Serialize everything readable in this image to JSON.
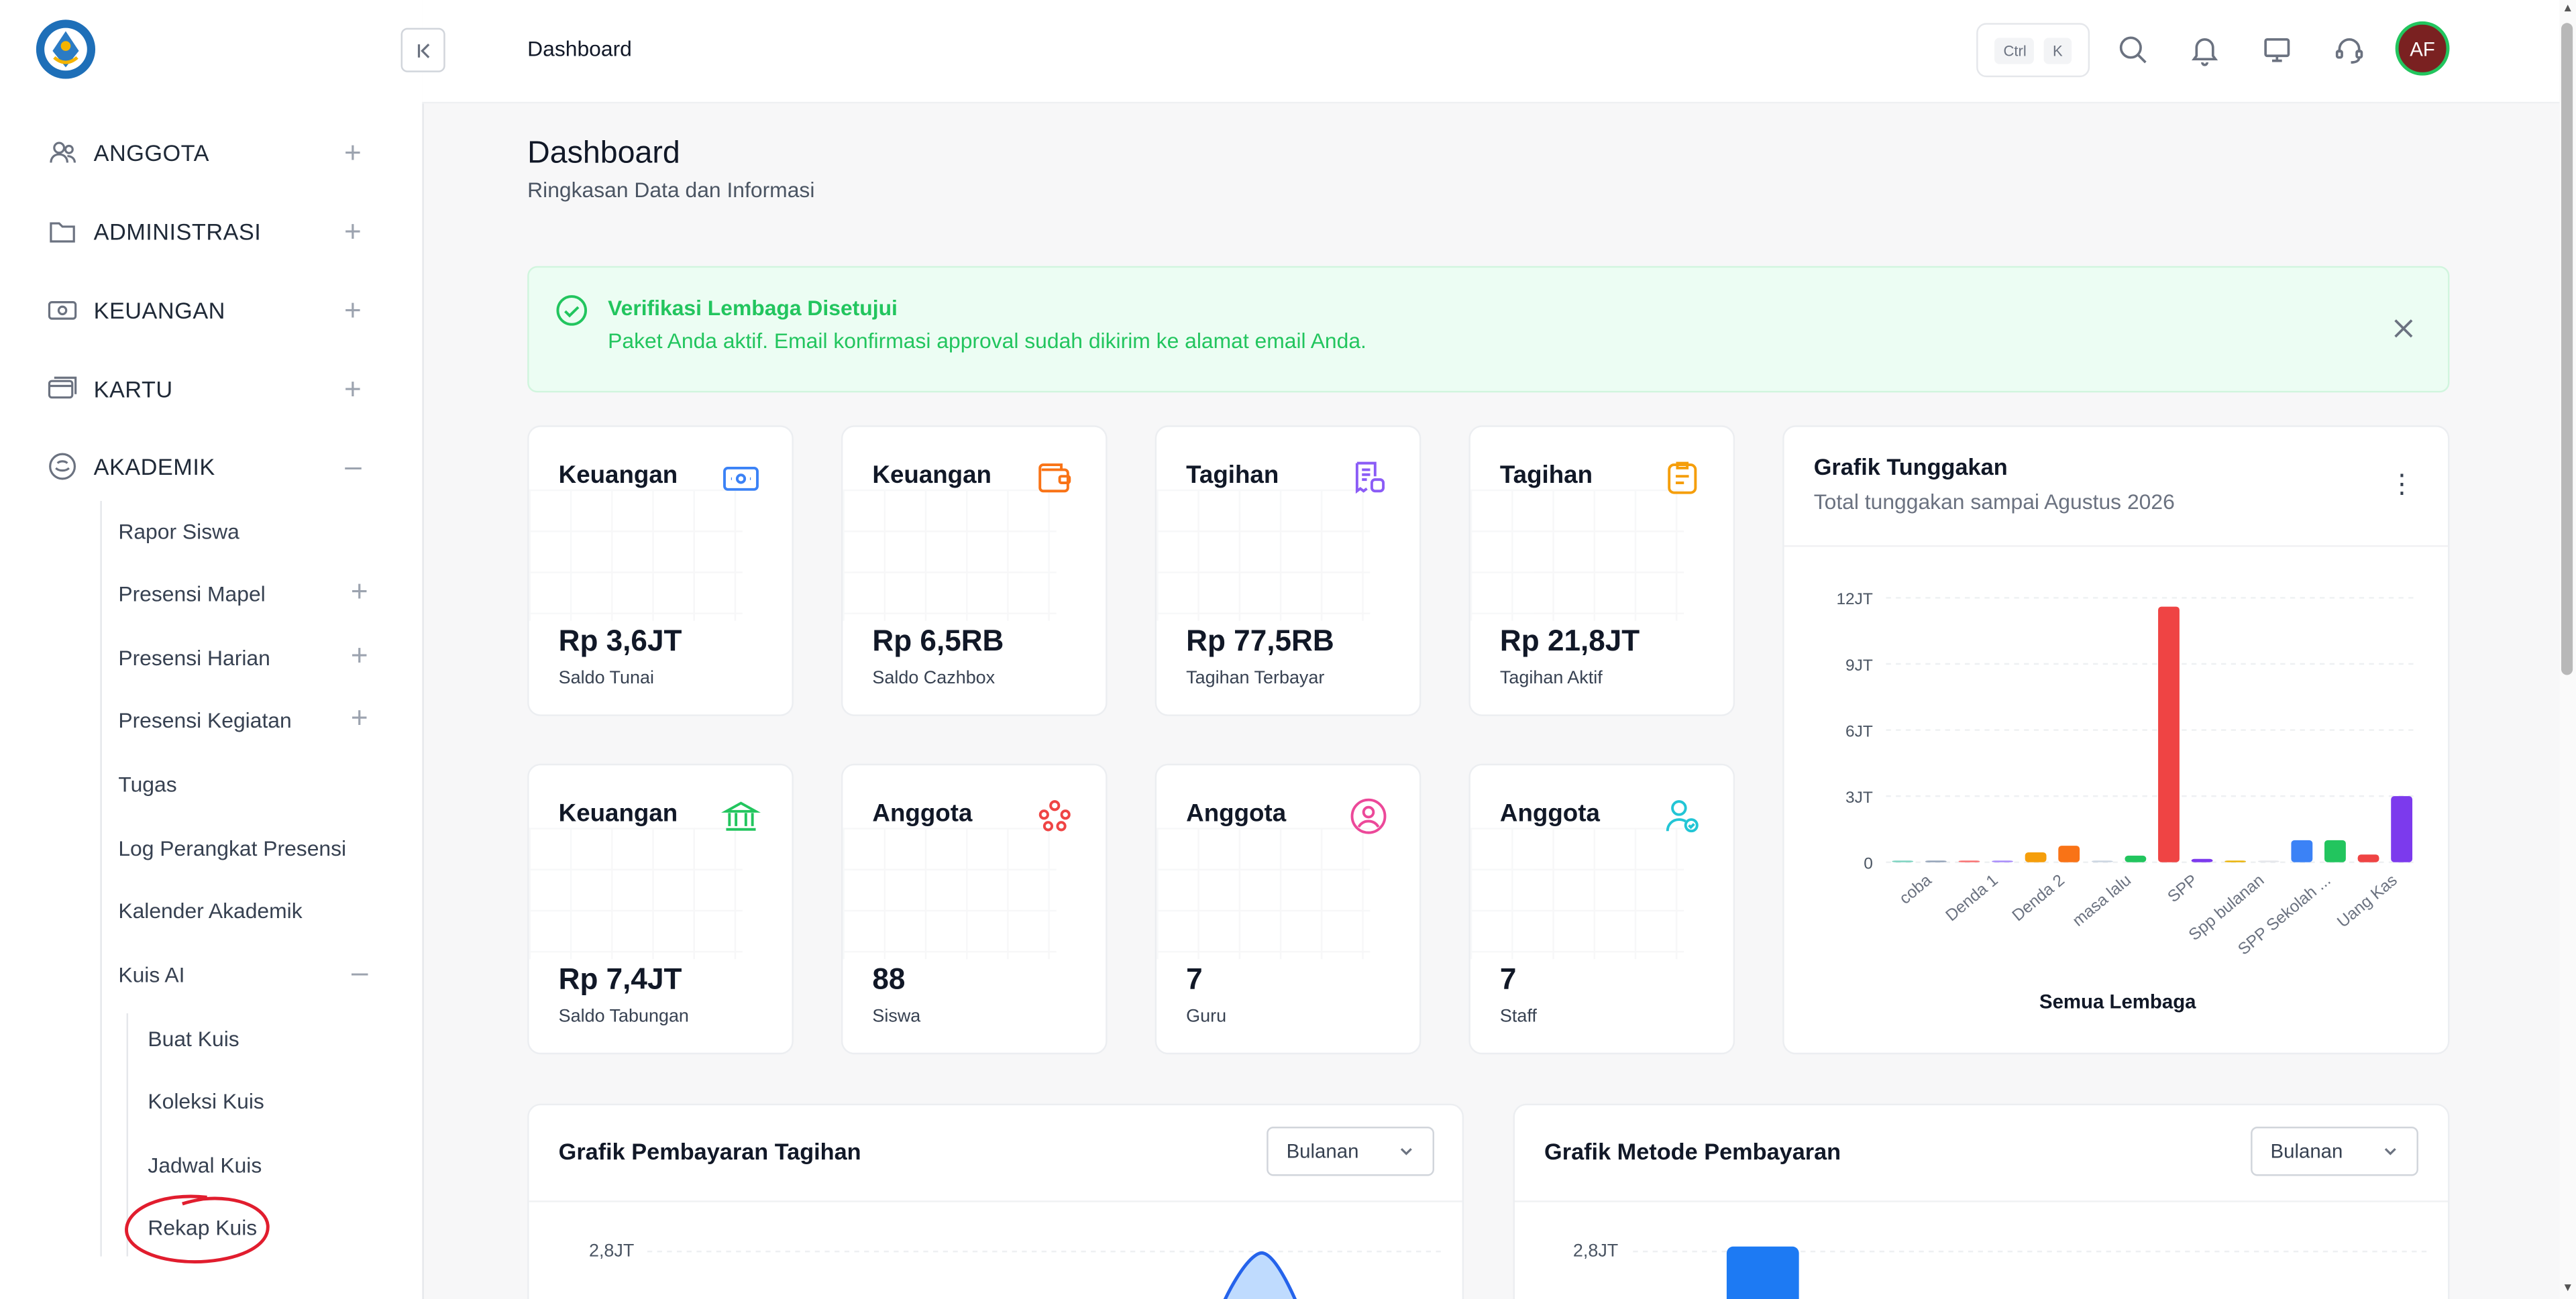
{
  "sidebar": {
    "items": [
      {
        "label": "ANGGOTA",
        "toggle": "+"
      },
      {
        "label": "ADMINISTRASI",
        "toggle": "+"
      },
      {
        "label": "KEUANGAN",
        "toggle": "+"
      },
      {
        "label": "KARTU",
        "toggle": "+"
      },
      {
        "label": "AKADEMIK",
        "toggle": "–"
      }
    ],
    "akademik_sub": [
      {
        "label": "Rapor Siswa",
        "toggle": ""
      },
      {
        "label": "Presensi Mapel",
        "toggle": "+"
      },
      {
        "label": "Presensi Harian",
        "toggle": "+"
      },
      {
        "label": "Presensi Kegiatan",
        "toggle": "+"
      },
      {
        "label": "Tugas",
        "toggle": ""
      },
      {
        "label": "Log Perangkat Presensi",
        "toggle": ""
      },
      {
        "label": "Kalender Akademik",
        "toggle": ""
      },
      {
        "label": "Kuis AI",
        "toggle": "–"
      }
    ],
    "kuis_sub": [
      {
        "label": "Buat Kuis"
      },
      {
        "label": "Koleksi Kuis"
      },
      {
        "label": "Jadwal Kuis"
      },
      {
        "label": "Rekap Kuis"
      }
    ]
  },
  "topbar": {
    "title": "Dashboard",
    "kbd_ctrl": "Ctrl",
    "kbd_k": "K",
    "avatar_initials": "AF"
  },
  "page": {
    "title": "Dashboard",
    "subtitle": "Ringkasan Data dan Informasi"
  },
  "alert": {
    "title": "Verifikasi Lembaga Disetujui",
    "text": "Paket Anda aktif. Email konfirmasi approval sudah dikirim ke alamat email Anda.",
    "color": "#22c55e"
  },
  "cards": [
    {
      "category": "Keuangan",
      "value": "Rp 3,6JT",
      "label": "Saldo Tunai",
      "icon": "money-icon",
      "color": "#3b82f6"
    },
    {
      "category": "Keuangan",
      "value": "Rp 6,5RB",
      "label": "Saldo Cazhbox",
      "icon": "wallet-icon",
      "color": "#f97316"
    },
    {
      "category": "Tagihan",
      "value": "Rp 77,5RB",
      "label": "Tagihan Terbayar",
      "icon": "bill-paid-icon",
      "color": "#8b5cf6"
    },
    {
      "category": "Tagihan",
      "value": "Rp 21,8JT",
      "label": "Tagihan Aktif",
      "icon": "bill-active-icon",
      "color": "#f59e0b"
    },
    {
      "category": "Keuangan",
      "value": "Rp 7,4JT",
      "label": "Saldo Tabungan",
      "icon": "bank-icon",
      "color": "#22c55e"
    },
    {
      "category": "Anggota",
      "value": "88",
      "label": "Siswa",
      "icon": "students-icon",
      "color": "#ef4444"
    },
    {
      "category": "Anggota",
      "value": "7",
      "label": "Guru",
      "icon": "teacher-icon",
      "color": "#ec4899"
    },
    {
      "category": "Anggota",
      "value": "7",
      "label": "Staff",
      "icon": "staff-icon",
      "color": "#22c5d5"
    }
  ],
  "tunggakan": {
    "title": "Grafik Tunggakan",
    "subtitle": "Total tunggakan sampai Agustus 2026",
    "footer": "Semua Lembaga"
  },
  "pembayaran": {
    "title": "Grafik Pembayaran Tagihan",
    "select": "Bulanan"
  },
  "metode": {
    "title": "Grafik Metode Pembayaran",
    "select": "Bulanan"
  },
  "chart_data": [
    {
      "type": "bar",
      "title": "Grafik Tunggakan",
      "ylim": [
        0,
        12000000
      ],
      "yticks": [
        "0",
        "3JT",
        "6JT",
        "9JT",
        "12JT"
      ],
      "ytick_values": [
        0,
        3000000,
        6000000,
        9000000,
        12000000
      ],
      "xlabels": [
        "coba",
        "Denda 1",
        "Denda 2",
        "masa lalu",
        "SPP",
        "Spp bulanan",
        "SPP Sekolah ...",
        "Uang Kas"
      ],
      "bars": [
        {
          "value": 30000,
          "color": "#7dd3c0"
        },
        {
          "value": 30000,
          "color": "#94a3b8"
        },
        {
          "value": 40000,
          "color": "#f87171"
        },
        {
          "value": 40000,
          "color": "#a78bfa"
        },
        {
          "value": 450000,
          "color": "#f59e0b"
        },
        {
          "value": 750000,
          "color": "#f97316"
        },
        {
          "value": 30000,
          "color": "#cbd5e1"
        },
        {
          "value": 300000,
          "color": "#22c55e"
        },
        {
          "value": 11600000,
          "color": "#ef4444"
        },
        {
          "value": 150000,
          "color": "#7c3aed"
        },
        {
          "value": 50000,
          "color": "#eab308"
        },
        {
          "value": 0,
          "color": "#e5e7eb"
        },
        {
          "value": 1000000,
          "color": "#3b82f6"
        },
        {
          "value": 1000000,
          "color": "#22c55e"
        },
        {
          "value": 350000,
          "color": "#ef4444"
        },
        {
          "value": 3000000,
          "color": "#7c3aed"
        }
      ],
      "grid": true
    },
    {
      "type": "area",
      "title": "Grafik Pembayaran Tagihan",
      "yticks": [
        "2,8JT"
      ],
      "color": "#3b82f6",
      "note": "peak visible, partially cut off"
    },
    {
      "type": "bar",
      "title": "Grafik Metode Pembayaran",
      "yticks": [
        "2,8JT"
      ],
      "color": "#3b82f6",
      "values": [
        2800000
      ]
    }
  ]
}
